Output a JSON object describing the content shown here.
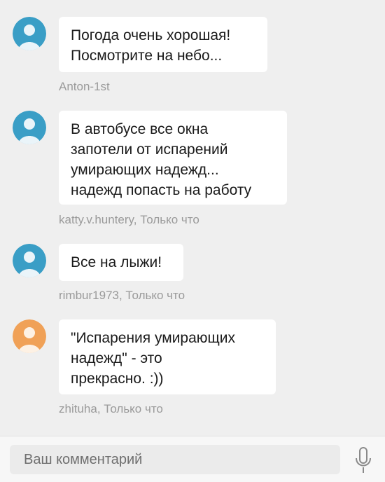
{
  "colors": {
    "page_bg": "#efefef",
    "bubble_bg": "#ffffff",
    "avatar_blue": "#3a9ec6",
    "avatar_orange": "#f0a157",
    "meta_text": "#9a9a9a"
  },
  "comments": [
    {
      "avatar_color": "blue",
      "lines": [
        "Погода очень хорошая!",
        "Посмотрите на небо..."
      ],
      "meta": "Anton-1st"
    },
    {
      "avatar_color": "blue",
      "lines": [
        "В автобусе все окна",
        "запотели от испарений",
        "умирающих надежд...",
        "надежд попасть на работу"
      ],
      "meta": "katty.v.huntery, Только что"
    },
    {
      "avatar_color": "blue",
      "lines": [
        "Все на лыжи!"
      ],
      "meta": "rimbur1973, Только что"
    },
    {
      "avatar_color": "orange",
      "lines": [
        "\"Испарения умирающих",
        "надежд\" - это",
        "прекрасно. :))"
      ],
      "meta": "zhituha, Только что"
    }
  ],
  "composer": {
    "placeholder": "Ваш комментарий",
    "mic_icon": "microphone-icon"
  }
}
